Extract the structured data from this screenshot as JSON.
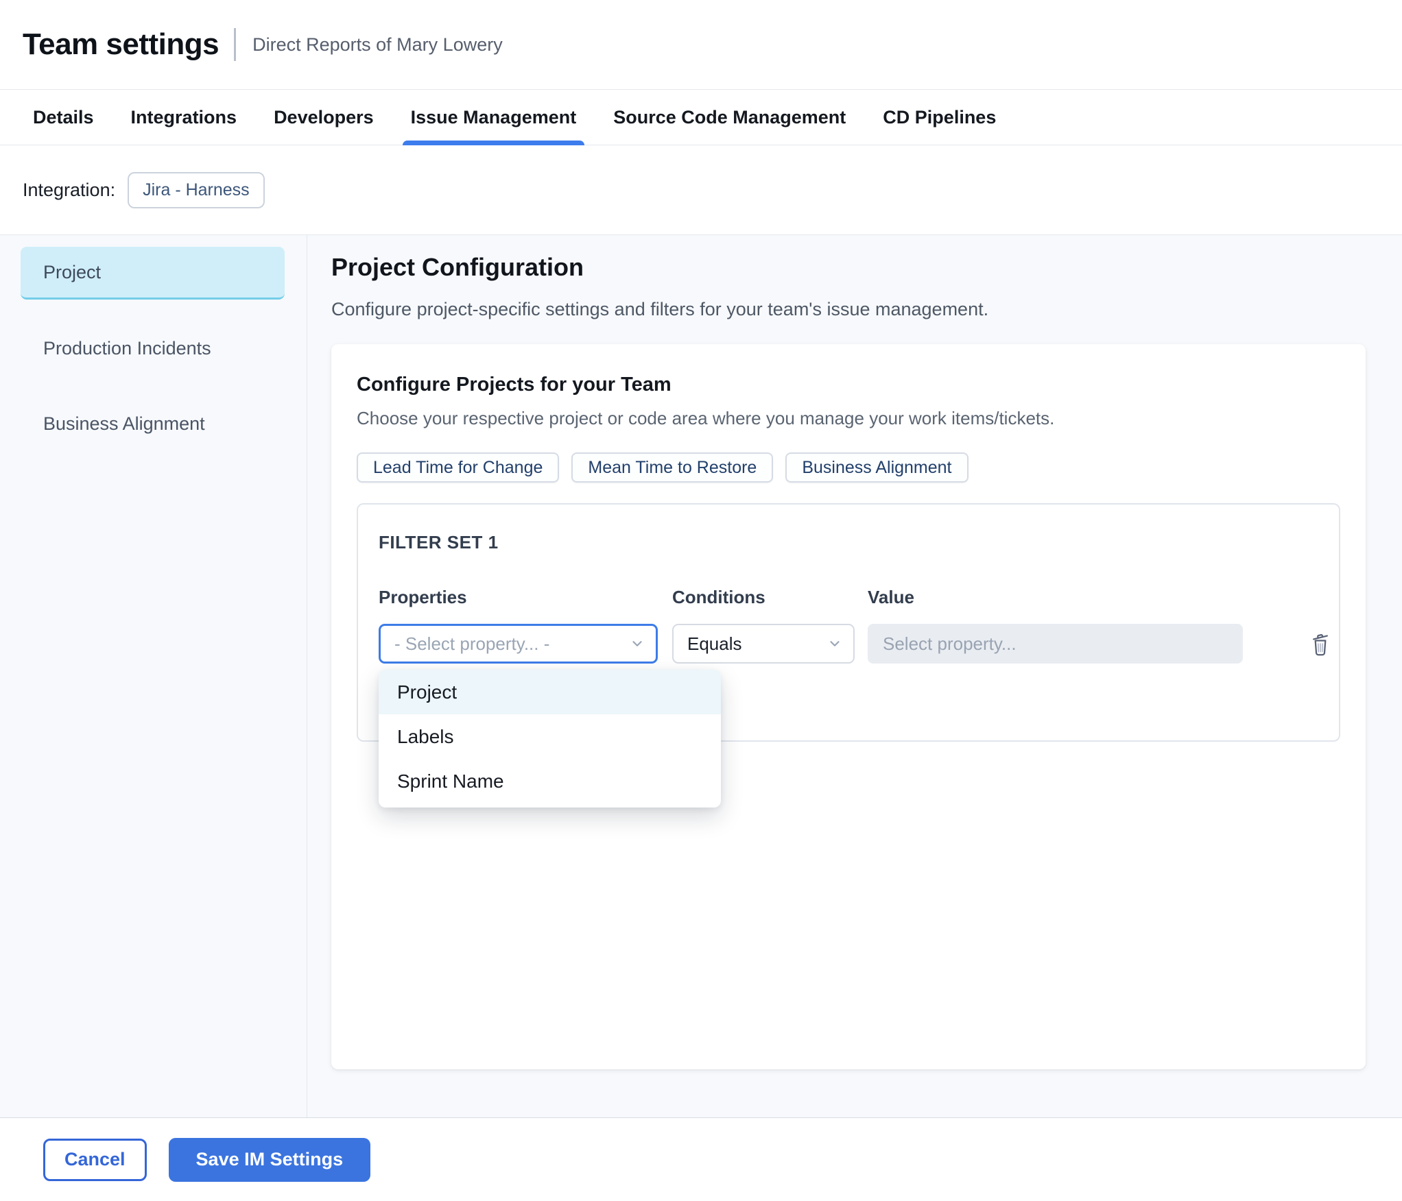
{
  "header": {
    "title": "Team settings",
    "subtitle": "Direct Reports of Mary Lowery"
  },
  "tabs": [
    {
      "label": "Details",
      "active": false
    },
    {
      "label": "Integrations",
      "active": false
    },
    {
      "label": "Developers",
      "active": false
    },
    {
      "label": "Issue Management",
      "active": true
    },
    {
      "label": "Source Code Management",
      "active": false
    },
    {
      "label": "CD Pipelines",
      "active": false
    }
  ],
  "integration_bar": {
    "label": "Integration:",
    "selected_integration": "Jira - Harness"
  },
  "sidebar": {
    "items": [
      {
        "label": "Project",
        "active": true
      },
      {
        "label": "Production Incidents",
        "active": false
      },
      {
        "label": "Business Alignment",
        "active": false
      }
    ]
  },
  "main": {
    "title": "Project Configuration",
    "subtitle": "Configure project-specific settings and filters for your team's issue management.",
    "card": {
      "title": "Configure Projects for your Team",
      "subtitle": "Choose your respective project or code area where you manage your work items/tickets.",
      "metric_tabs": [
        {
          "label": "Lead Time for Change"
        },
        {
          "label": "Mean Time to Restore"
        },
        {
          "label": "Business Alignment"
        }
      ],
      "filter_set": {
        "title": "FILTER SET 1",
        "columns": {
          "properties": "Properties",
          "conditions": "Conditions",
          "value": "Value"
        },
        "property_select": {
          "placeholder": "- Select property... -"
        },
        "condition_select": {
          "value": "Equals"
        },
        "value_field": {
          "placeholder": "Select property..."
        },
        "property_options": [
          {
            "label": "Project",
            "highlighted": true
          },
          {
            "label": "Labels",
            "highlighted": false
          },
          {
            "label": "Sprint Name",
            "highlighted": false
          }
        ]
      }
    }
  },
  "footer": {
    "cancel_label": "Cancel",
    "save_label": "Save IM Settings"
  },
  "icons": {
    "property_select": "chevron-down-icon",
    "condition_select": "chevron-down-icon",
    "remove_filter": "trash-icon"
  },
  "colors": {
    "accent_blue": "#3b74df",
    "active_tab_underline": "#3d7cec",
    "focused_select_border": "#3e7ce8",
    "selected_nav_bg": "#cfeef9",
    "selected_nav_border": "#74cde9",
    "dropdown_highlight": "#ecf6fb",
    "content_bg": "#f7f9fc",
    "border": "#e5e8ee",
    "disabled_field_bg": "#e9edf2",
    "placeholder_text": "#9aa5b4",
    "metric_chip_text": "#22406b",
    "integration_chip_text": "#3c567a"
  }
}
